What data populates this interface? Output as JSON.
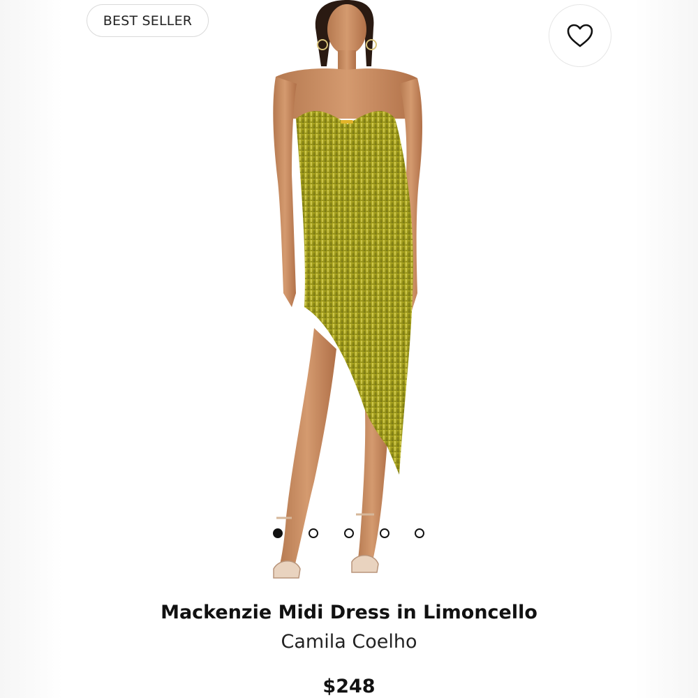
{
  "badge": {
    "label": "BEST SELLER"
  },
  "favorite": {
    "icon": "heart-outline-icon"
  },
  "product": {
    "image_icon": "product-photo-icon",
    "name": "Mackenzie Midi Dress in Limoncello",
    "brand": "Camila Coelho",
    "price": "$248",
    "dress_color": "#a6a21f"
  },
  "carousel": {
    "total": 5,
    "active_index": 0
  }
}
